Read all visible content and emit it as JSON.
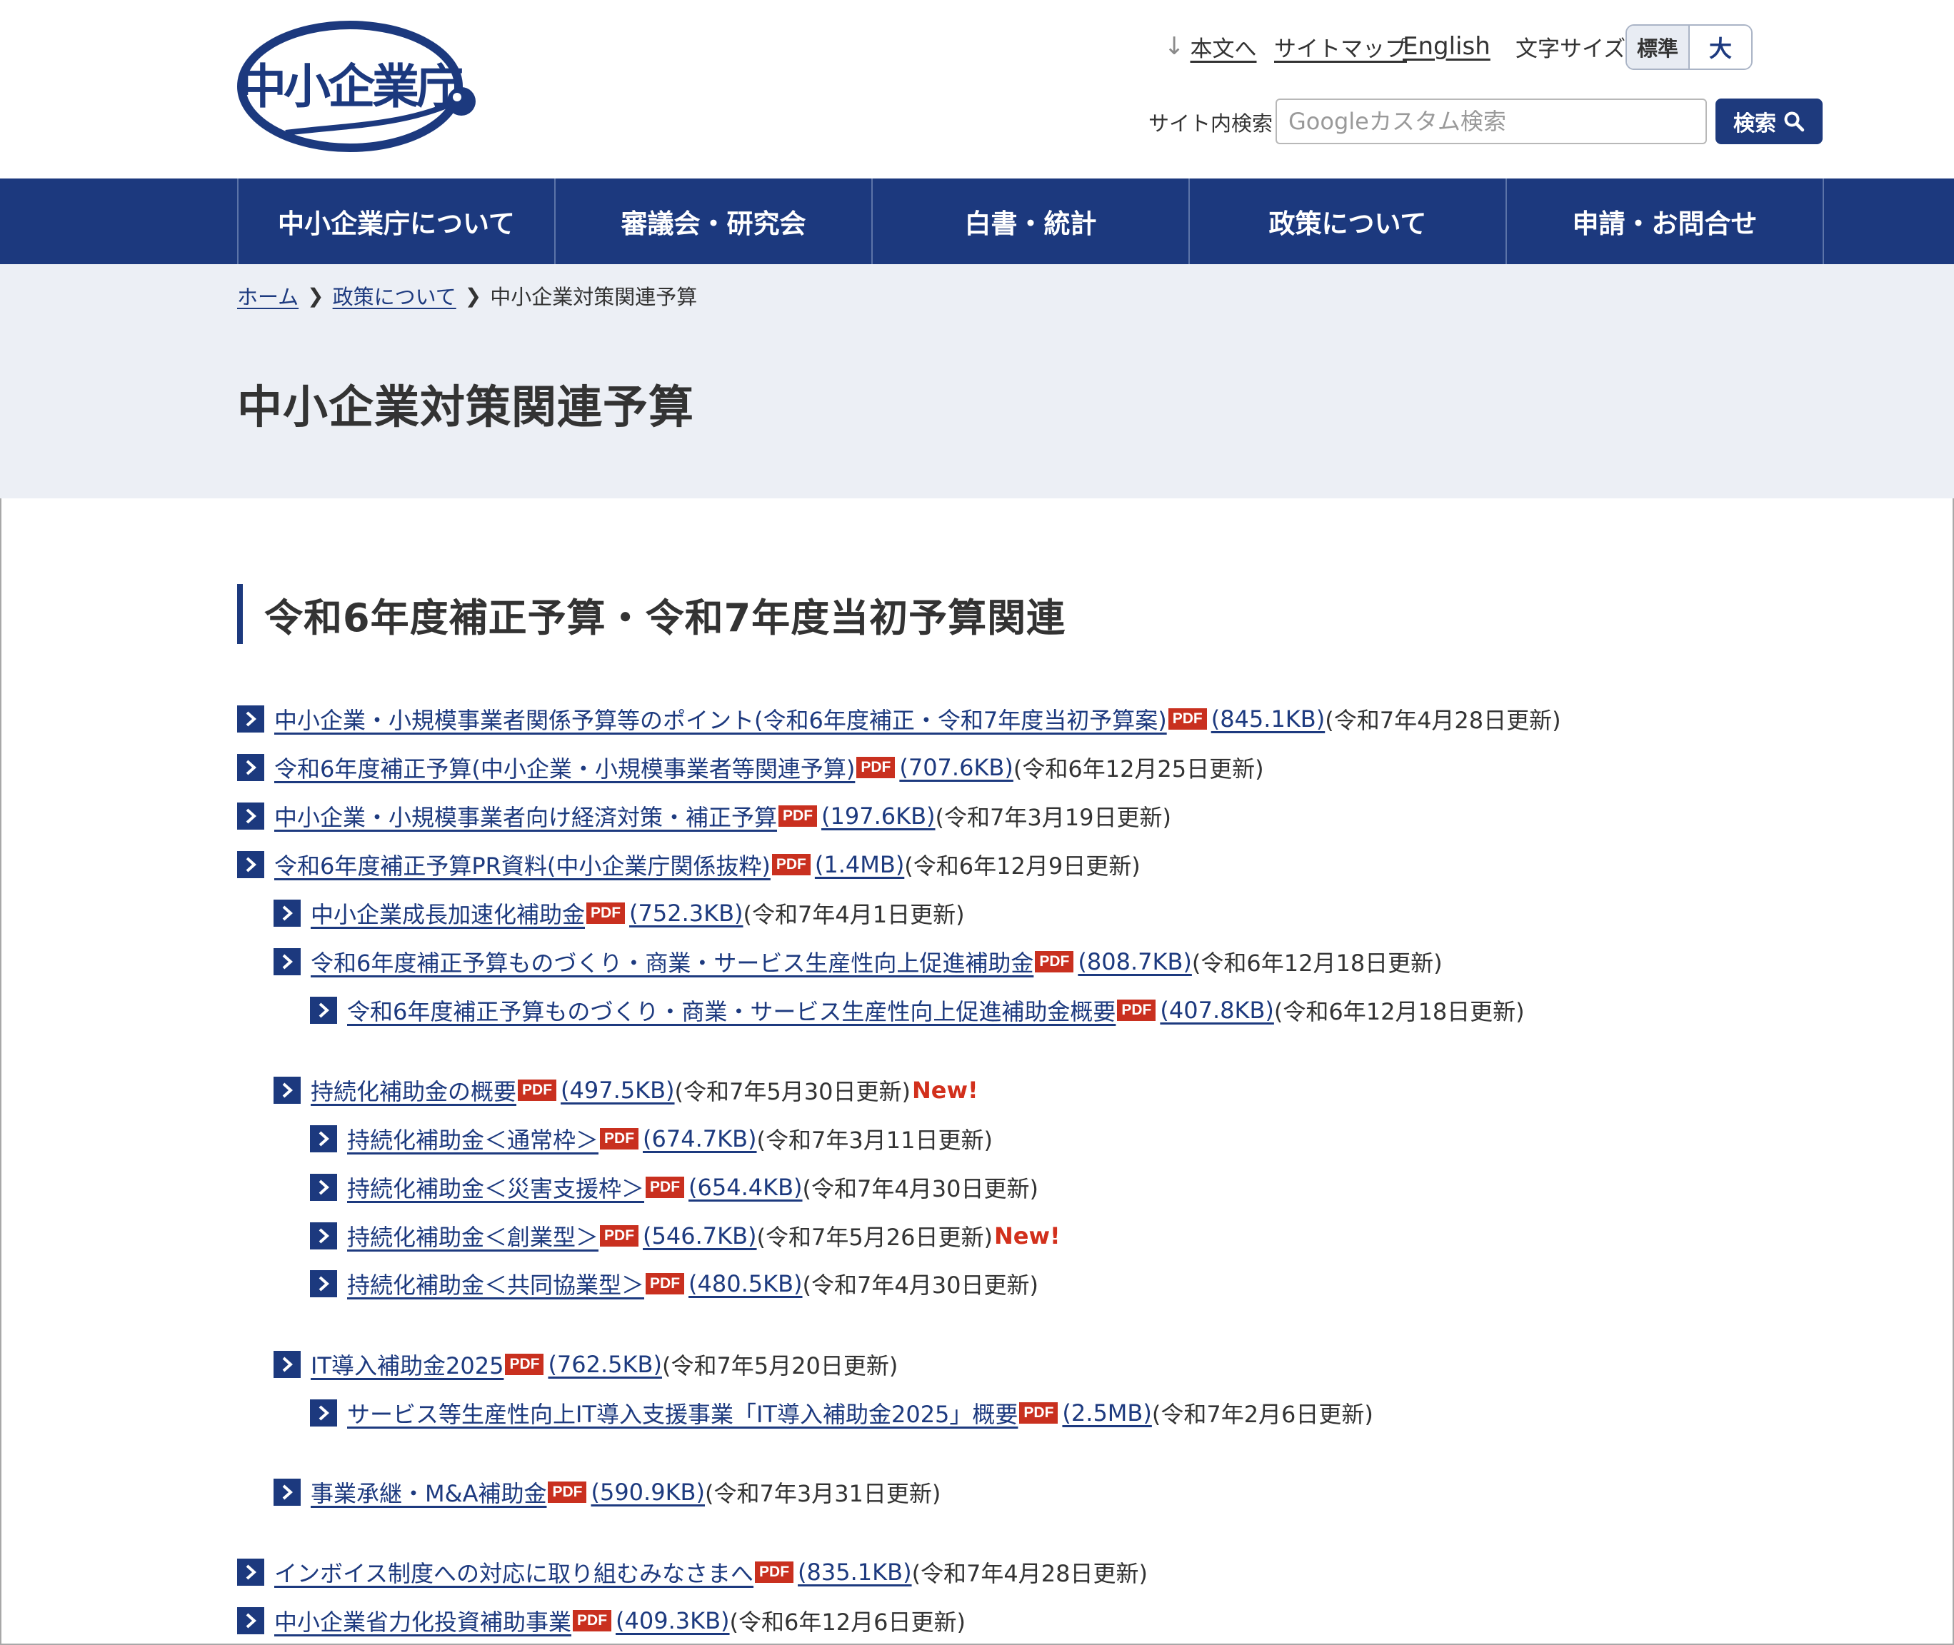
{
  "header": {
    "logo_text": "中小企業庁",
    "skip_link": "本文へ",
    "sitemap": "サイトマップ",
    "english": "English",
    "font_size_label": "文字サイズ",
    "font_size_standard": "標準",
    "font_size_large": "大",
    "search_label": "サイト内検索",
    "search_placeholder": "Googleカスタム検索",
    "search_button": "検索"
  },
  "nav": {
    "items": [
      "中小企業庁について",
      "審議会・研究会",
      "白書・統計",
      "政策について",
      "申請・お問合せ"
    ]
  },
  "breadcrumb": {
    "home": "ホーム",
    "policy": "政策について",
    "current": "中小企業対策関連予算"
  },
  "page_title": "中小企業対策関連予算",
  "section": {
    "title": "令和6年度補正予算・令和7年度当初予算関連",
    "pdf_label": "PDF",
    "new_label": "New!",
    "items": [
      {
        "text": "中小企業・小規模事業者関係予算等のポイント(令和6年度補正・令和7年度当初予算案)",
        "size": "(845.1KB)",
        "date": "(令和7年4月28日更新)"
      },
      {
        "text": "令和6年度補正予算(中小企業・小規模事業者等関連予算)",
        "size": "(707.6KB)",
        "date": "(令和6年12月25日更新)"
      },
      {
        "text": "中小企業・小規模事業者向け経済対策・補正予算",
        "size": "(197.6KB)",
        "date": "(令和7年3月19日更新)"
      },
      {
        "text": "令和6年度補正予算PR資料(中小企業庁関係抜粋)",
        "size": "(1.4MB)",
        "date": "(令和6年12月9日更新)"
      },
      {
        "text": "中小企業成長加速化補助金",
        "size": "(752.3KB)",
        "date": "(令和7年4月1日更新)"
      },
      {
        "text": "令和6年度補正予算ものづくり・商業・サービス生産性向上促進補助金",
        "size": "(808.7KB)",
        "date": "(令和6年12月18日更新)"
      },
      {
        "text": "令和6年度補正予算ものづくり・商業・サービス生産性向上促進補助金概要",
        "size": "(407.8KB)",
        "date": "(令和6年12月18日更新)"
      },
      {
        "text": "持続化補助金の概要",
        "size": "(497.5KB)",
        "date": "(令和7年5月30日更新)"
      },
      {
        "text": "持続化補助金＜通常枠＞",
        "size": "(674.7KB)",
        "date": "(令和7年3月11日更新)"
      },
      {
        "text": "持続化補助金＜災害支援枠＞",
        "size": "(654.4KB)",
        "date": "(令和7年4月30日更新)"
      },
      {
        "text": "持続化補助金＜創業型＞",
        "size": "(546.7KB)",
        "date": "(令和7年5月26日更新)"
      },
      {
        "text": "持続化補助金＜共同協業型＞",
        "size": "(480.5KB)",
        "date": "(令和7年4月30日更新)"
      },
      {
        "text": "IT導入補助金2025",
        "size": "(762.5KB)",
        "date": "(令和7年5月20日更新)"
      },
      {
        "text": "サービス等生産性向上IT導入支援事業「IT導入補助金2025」概要",
        "size": "(2.5MB)",
        "date": "(令和7年2月6日更新)"
      },
      {
        "text": "事業承継・M&A補助金",
        "size": "(590.9KB)",
        "date": "(令和7年3月31日更新)"
      },
      {
        "text": "インボイス制度への対応に取り組むみなさまへ",
        "size": "(835.1KB)",
        "date": "(令和7年4月28日更新)"
      },
      {
        "text": "中小企業省力化投資補助事業",
        "size": "(409.3KB)",
        "date": "(令和6年12月6日更新)"
      }
    ]
  },
  "colors": {
    "brand": "#1c397e",
    "pdf_badge": "#c9301f",
    "new_badge": "#d2301c",
    "band": "#eceff5"
  }
}
